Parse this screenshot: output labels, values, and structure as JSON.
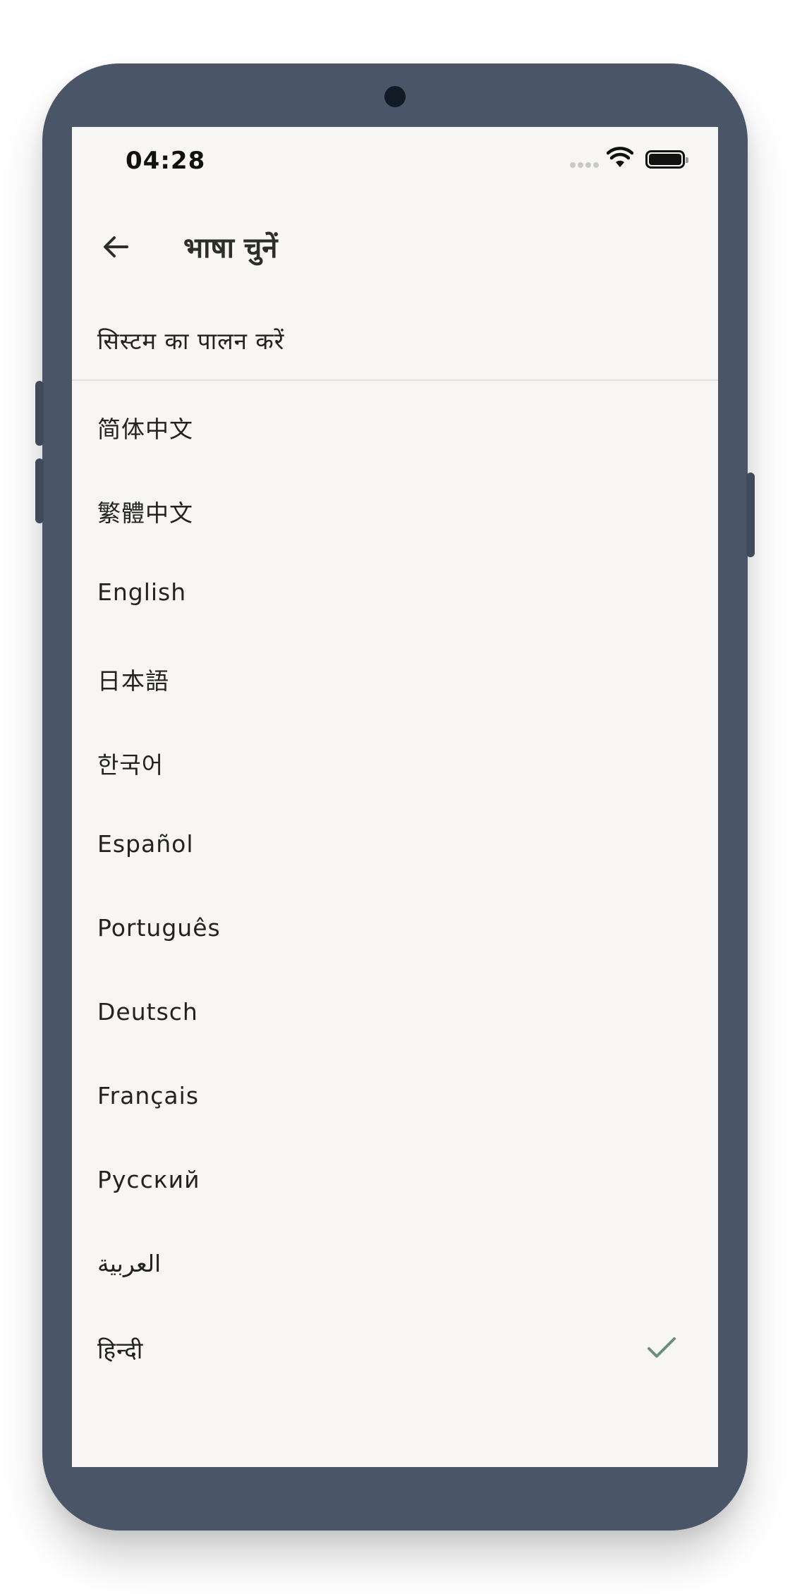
{
  "status_bar": {
    "time": "04:28"
  },
  "header": {
    "title": "भाषा चुनें",
    "back_icon": "arrow-left-icon"
  },
  "follow_system": {
    "label": "सिस्टम का पालन करें"
  },
  "languages": [
    {
      "label": "简体中文",
      "selected": false
    },
    {
      "label": "繁體中文",
      "selected": false
    },
    {
      "label": "English",
      "selected": false
    },
    {
      "label": "日本語",
      "selected": false
    },
    {
      "label": "한국어",
      "selected": false
    },
    {
      "label": "Español",
      "selected": false
    },
    {
      "label": "Português",
      "selected": false
    },
    {
      "label": "Deutsch",
      "selected": false
    },
    {
      "label": "Français",
      "selected": false
    },
    {
      "label": "Русский",
      "selected": false
    },
    {
      "label": "العربية",
      "selected": false
    },
    {
      "label": "हिन्दी",
      "selected": true
    }
  ],
  "colors": {
    "phone_frame": "#4a5568",
    "screen_background": "#f7f6f2",
    "check_accent": "#6b8f7b"
  }
}
